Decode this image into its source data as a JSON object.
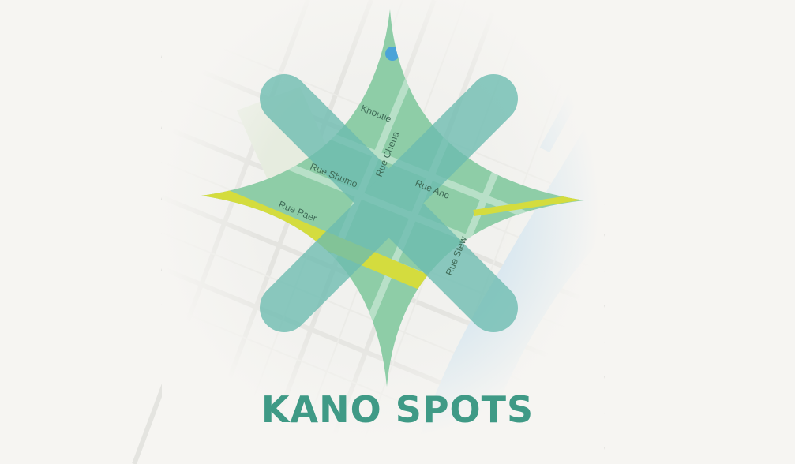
{
  "logo": {
    "title": "KANO SPOTS",
    "icon_name": "kano-spots-logo-icon",
    "colors": {
      "brand_teal": "#3f9a86",
      "cross_teal": "#6fbfb0",
      "star_green": "#8fcba5",
      "highway_yellow": "#d4dc3e",
      "water_blue": "#cfe2ee"
    }
  },
  "map": {
    "street_labels": [
      "Rue Paer",
      "Rue Shumo",
      "Rue Chena",
      "Rue Anc",
      "Rue Stew",
      "Khoutie"
    ]
  }
}
